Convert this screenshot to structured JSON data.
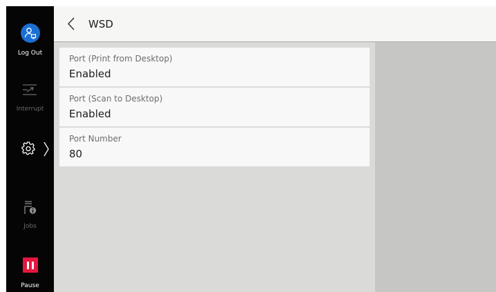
{
  "sidebar": {
    "logout_label": "Log Out",
    "interrupt_label": "Interrupt",
    "jobs_label": "Jobs",
    "pause_label": "Pause"
  },
  "header": {
    "title": "WSD"
  },
  "settings": [
    {
      "label": "Port (Print from Desktop)",
      "value": "Enabled"
    },
    {
      "label": "Port (Scan to Desktop)",
      "value": "Enabled"
    },
    {
      "label": "Port Number",
      "value": "80"
    }
  ],
  "colors": {
    "accent_blue": "#1b6fd3",
    "pause_red": "#e5173f",
    "rail_background": "#050505"
  },
  "icons": {
    "logout": "user-logout-icon",
    "interrupt": "interrupt-icon",
    "settings": "gear-icon",
    "jobs": "jobs-icon",
    "pause": "pause-icon",
    "back": "chevron-left-icon"
  }
}
